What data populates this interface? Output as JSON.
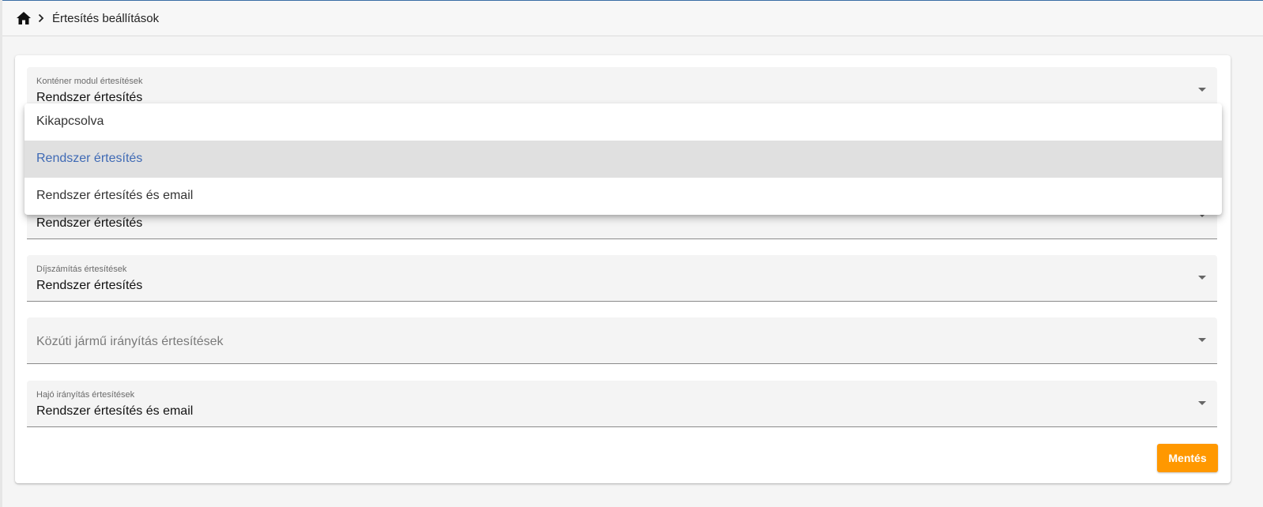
{
  "breadcrumb": {
    "home_icon": "home-icon",
    "separator_icon": "chevron-right-icon",
    "current_page": "Értesítés beállítások"
  },
  "fields": [
    {
      "label": "Konténer modul értesítések",
      "value": "Rendszer értesítés"
    },
    {
      "label": "",
      "value": "Rendszer értesítés"
    },
    {
      "label": "Díjszámítás értesítések",
      "value": "Rendszer értesítés"
    },
    {
      "label": "",
      "placeholder": "Közúti jármű irányítás értesítések"
    },
    {
      "label": "Hajó irányítás értesítések",
      "value": "Rendszer értesítés és email"
    }
  ],
  "dropdown": {
    "options": [
      "Kikapcsolva",
      "Rendszer értesítés",
      "Rendszer értesítés és email"
    ],
    "selected": "Rendszer értesítés"
  },
  "actions": {
    "save_label": "Mentés"
  },
  "colors": {
    "accent": "#ff9800",
    "selected_option_text": "#3f6ab5",
    "top_border": "#3a6ea5"
  }
}
